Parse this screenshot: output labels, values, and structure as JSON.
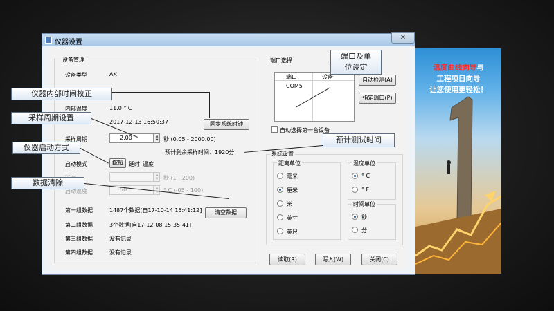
{
  "window": {
    "title": "仪器设置",
    "close_glyph": "✕"
  },
  "device": {
    "section_title": "设备管理",
    "type_label": "设备类型",
    "type_value": "AK",
    "temp_label": "内部温度",
    "temp_value": "11.0 ° C",
    "datetime_value": "2017-12-13 16:50:37",
    "sync_time_button": "同步系统时钟",
    "period_label": "采样周期",
    "period_value": "2.00",
    "period_unit_range": "秒 (0.05 - 2000.00)",
    "remaining_label": "预计剩余采样时间：1920分",
    "start_mode_label": "启动模式",
    "start_mode_button": "按钮",
    "start_mode_delay": "延时",
    "start_mode_temp": "温度",
    "delay_label": "延时",
    "delay_unit_range": "秒 (1 - 200)",
    "start_temp_label": "启动温度",
    "start_temp_value": "50",
    "start_temp_unit_range": "° C (-05 - 100)"
  },
  "data_groups": {
    "clear_button": "清空数据",
    "rows": [
      {
        "label": "第一组数据",
        "value": "1487个数据[自17-10-14 15:41:12]"
      },
      {
        "label": "第二组数据",
        "value": "3个数据[自17-12-08 15:35:41]"
      },
      {
        "label": "第三组数据",
        "value": "没有记录"
      },
      {
        "label": "第四组数据",
        "value": "没有记录"
      }
    ]
  },
  "port": {
    "section_title": "端口选择",
    "col_port": "端口",
    "col_device": "设备",
    "row_port": "COM5",
    "auto_detect_button": "自动检测(A)",
    "specify_port_button": "指定端口(P)",
    "auto_select_label": "自动选择第一台设备"
  },
  "system": {
    "section_title": "系统设置",
    "distance_title": "距离单位",
    "distance_options": [
      "毫米",
      "厘米",
      "米",
      "英寸",
      "英尺"
    ],
    "distance_selected": 1,
    "temp_unit_title": "温度单位",
    "temp_unit_options": [
      "° C",
      "° F"
    ],
    "time_unit_title": "时间单位",
    "time_unit_options": [
      "秒",
      "分"
    ]
  },
  "footer": {
    "read_button": "读取(R)",
    "write_button": "写入(W)",
    "close_button": "关闭(C)"
  },
  "callouts": {
    "port_setup": "端口及单\n位设定",
    "internal_time": "仪器内部时间校正",
    "sampling_period": "采样周期设置",
    "startup_mode": "仪器启动方式",
    "clear_data": "数据清除",
    "estimated_time": "预计测试时间"
  },
  "promo": {
    "line1_red": "温度曲线向导",
    "line1_white": "与",
    "line2_red": "工程项目向导",
    "line3_white": "让您使用更轻松！"
  },
  "colors": {
    "accent_red": "#ff2a2a",
    "window_border": "#6e8aa8"
  }
}
